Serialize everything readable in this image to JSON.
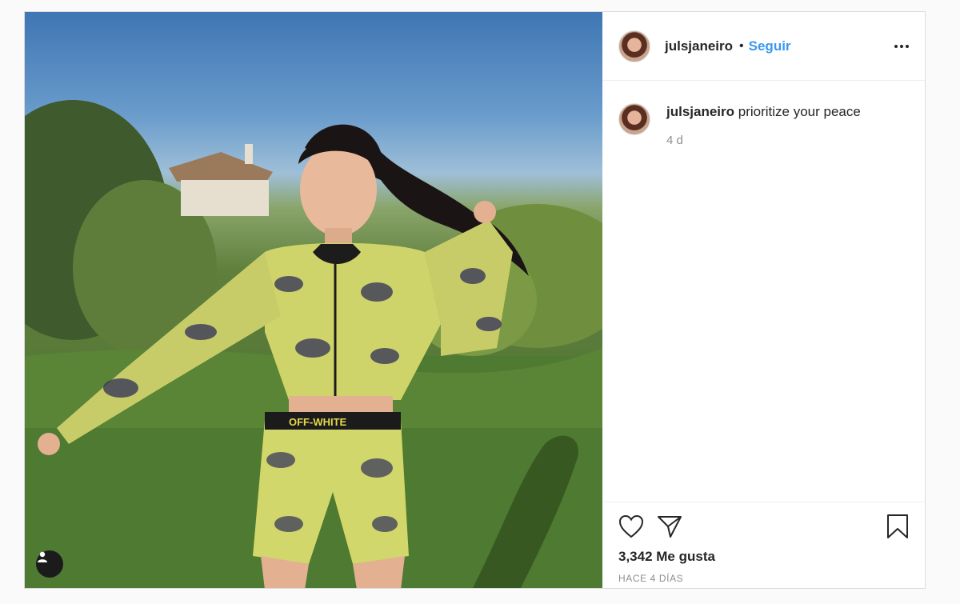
{
  "post": {
    "username": "julsjaneiro",
    "follow_label": "Seguir",
    "caption_user": "julsjaneiro",
    "caption_text": "prioritize your peace",
    "caption_time": "4 d",
    "likes": "3,342 Me gusta",
    "posted_ago": "HACE 4 DÍAS"
  },
  "icons": {
    "more": "more-options-icon",
    "like": "heart-icon",
    "share": "paper-plane-icon",
    "save": "bookmark-icon",
    "tags": "user-tag-icon"
  }
}
